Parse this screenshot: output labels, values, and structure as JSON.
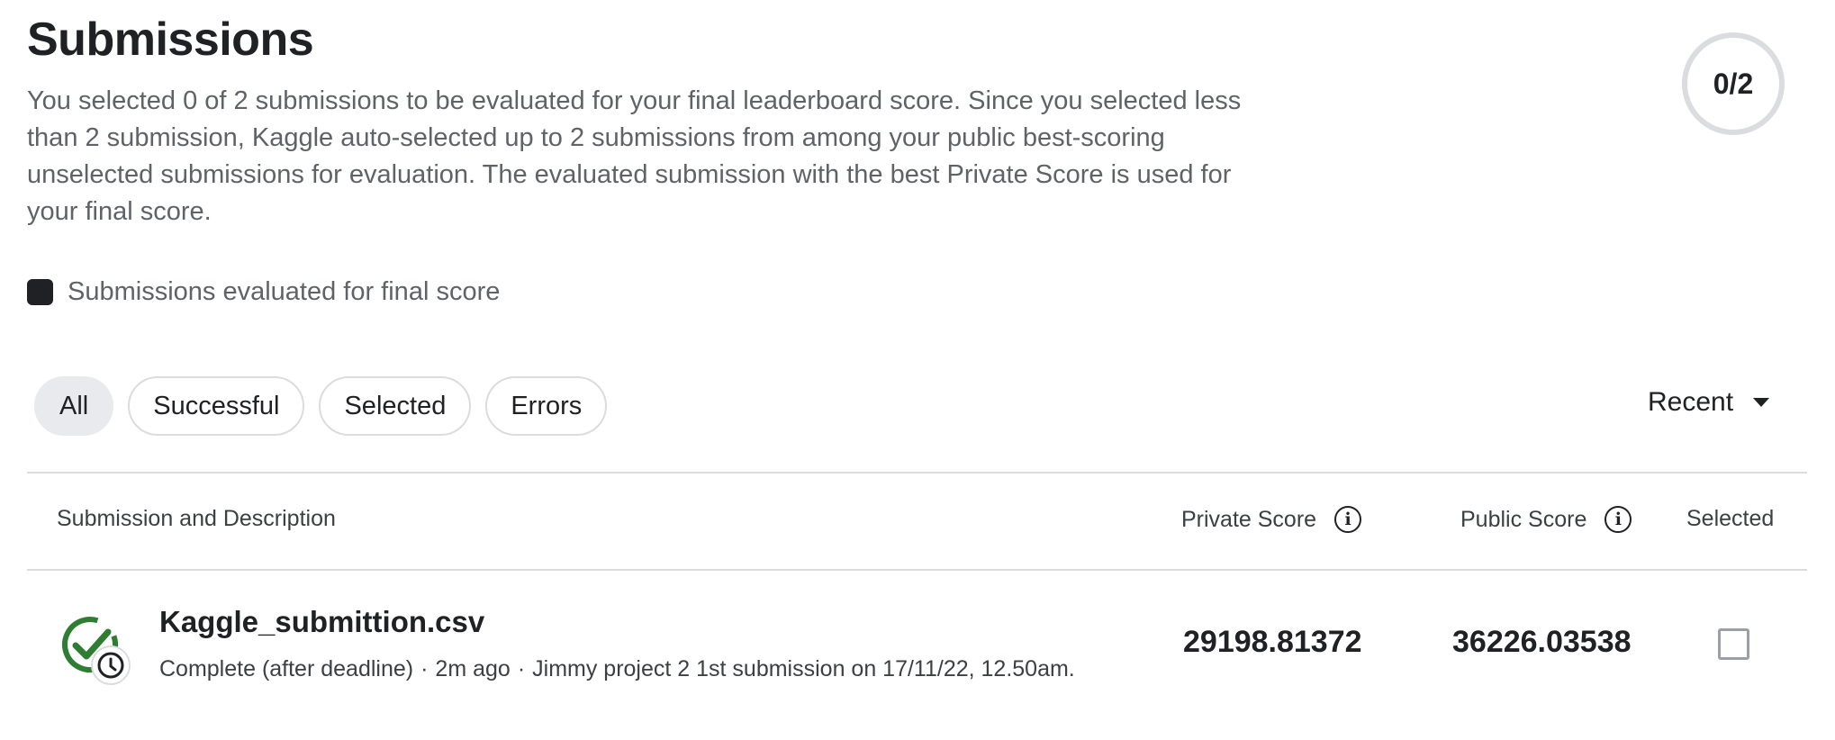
{
  "header": {
    "title": "Submissions",
    "description": "You selected 0 of 2 submissions to be evaluated for your final leaderboard score. Since you selected less than 2 submission, Kaggle auto-selected up to 2 submissions from among your public best-scoring unselected submissions for evaluation. The evaluated submission with the best Private Score is used for your final score.",
    "counter": "0/2"
  },
  "legend": {
    "label": "Submissions evaluated for final score",
    "color": "#202124"
  },
  "filters": [
    {
      "label": "All",
      "active": true
    },
    {
      "label": "Successful",
      "active": false
    },
    {
      "label": "Selected",
      "active": false
    },
    {
      "label": "Errors",
      "active": false
    }
  ],
  "sort": {
    "label": "Recent",
    "icon": "dropdown-arrow-icon"
  },
  "table": {
    "columns": {
      "submission": "Submission and Description",
      "private": "Private Score",
      "public": "Public Score",
      "selected": "Selected"
    },
    "rows": [
      {
        "file_name": "Kaggle_submittion.csv",
        "status": "Complete (after deadline)",
        "time": "2m ago",
        "description": "Jimmy project 2 1st submission on 17/11/22, 12.50am.",
        "private_score": "29198.81372",
        "public_score": "36226.03538",
        "selected": false,
        "status_icon": "check-clock-icon"
      }
    ]
  },
  "colors": {
    "success": "#2e7d32",
    "text": "#202124",
    "muted": "#5f6368",
    "border": "#dadce0"
  }
}
